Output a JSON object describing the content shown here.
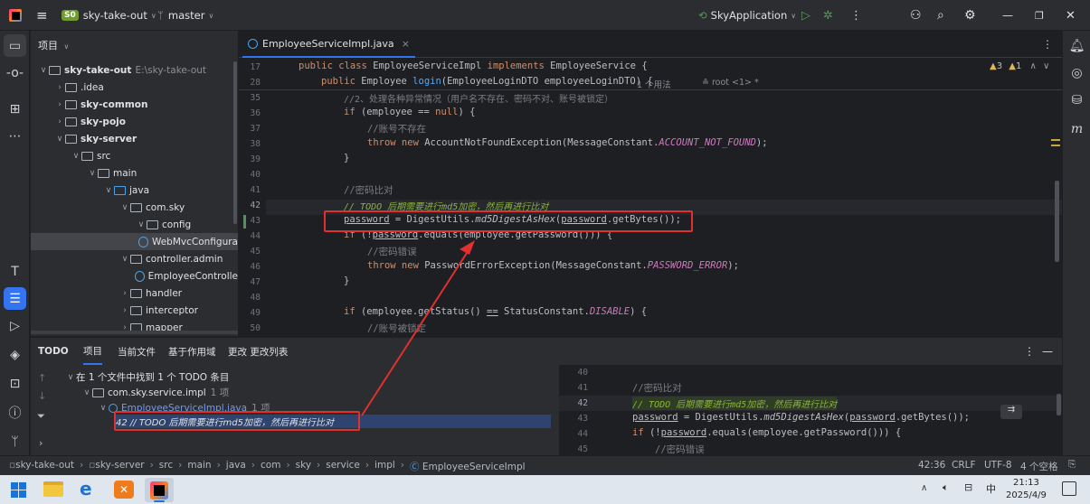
{
  "titlebar": {
    "app_badge": "S0",
    "project": "sky-take-out",
    "branch": "master",
    "run_config": "SkyApplication"
  },
  "project_panel": {
    "title": "项目",
    "root": {
      "name": "sky-take-out",
      "path": "E:\\sky-take-out"
    },
    "items": [
      ".idea",
      "sky-common",
      "sky-pojo",
      "sky-server",
      "src",
      "main",
      "java",
      "com.sky",
      "config",
      "WebMvcConfigura",
      "controller.admin",
      "EmployeeControlle",
      "handler",
      "interceptor",
      "mapper"
    ]
  },
  "editor": {
    "tab": "EmployeeServiceImpl.java",
    "inspections": {
      "warnings": "3",
      "weak": "1"
    },
    "sticky": [
      {
        "ln": "17",
        "text": "public class EmployeeServiceImpl implements EmployeeService {"
      },
      {
        "ln": "28",
        "text": "public Employee login(EmployeeLoginDTO employeeLoginDTO) {",
        "hint1": "1 个用法",
        "hint2": "root <1> *"
      }
    ],
    "lines": [
      {
        "ln": "35",
        "text": "//2、处理各种异常情况（用户名不存在、密码不对、账号被锁定）"
      },
      {
        "ln": "36",
        "text": "if (employee == null) {"
      },
      {
        "ln": "37",
        "text": "//账号不存在"
      },
      {
        "ln": "38",
        "text": "throw new AccountNotFoundException(MessageConstant.ACCOUNT_NOT_FOUND);"
      },
      {
        "ln": "39",
        "text": "}"
      },
      {
        "ln": "40",
        "text": ""
      },
      {
        "ln": "41",
        "text": "//密码比对"
      },
      {
        "ln": "42",
        "text": "// TODO 后期需要进行md5加密，然后再进行比对"
      },
      {
        "ln": "43",
        "text": "password = DigestUtils.md5DigestAsHex(password.getBytes());"
      },
      {
        "ln": "44",
        "text": "if (!password.equals(employee.getPassword())) {"
      },
      {
        "ln": "45",
        "text": "//密码错误"
      },
      {
        "ln": "46",
        "text": "throw new PasswordErrorException(MessageConstant.PASSWORD_ERROR);"
      },
      {
        "ln": "47",
        "text": "}"
      },
      {
        "ln": "48",
        "text": ""
      },
      {
        "ln": "49",
        "text": "if (employee.getStatus() == StatusConstant.DISABLE) {"
      },
      {
        "ln": "50",
        "text": "//账号被锁定"
      }
    ]
  },
  "bottom_panel": {
    "tabs": [
      "TODO",
      "项目",
      "当前文件",
      "基于作用域",
      "更改 更改列表"
    ],
    "summary": "在 1 个文件中找到 1 个 TODO 条目",
    "package": "com.sky.service.impl",
    "package_count": "1 项",
    "file": "EmployeeServiceImpl.java",
    "file_count": "1 项",
    "todo_item": "42 // TODO 后期需要进行md5加密，然后再进行比对",
    "preview_lines": [
      {
        "ln": "40",
        "text": ""
      },
      {
        "ln": "41",
        "text": "//密码比对"
      },
      {
        "ln": "42",
        "text": "// TODO 后期需要进行md5加密，然后再进行比对"
      },
      {
        "ln": "43",
        "text": "password = DigestUtils.md5DigestAsHex(password.getBytes());"
      },
      {
        "ln": "44",
        "text": "if (!password.equals(employee.getPassword())) {"
      },
      {
        "ln": "45",
        "text": "//密码错误"
      }
    ]
  },
  "statusbar": {
    "breadcrumb": [
      "sky-take-out",
      "sky-server",
      "src",
      "main",
      "java",
      "com",
      "sky",
      "service",
      "impl",
      "EmployeeServiceImpl"
    ],
    "position": "42:36",
    "line_sep": "CRLF",
    "encoding": "UTF-8",
    "indent": "4 个空格"
  },
  "taskbar": {
    "ime": "中",
    "time": "21:13",
    "date": "2025/4/9"
  },
  "colors": {
    "accent": "#3574f0",
    "annotation": "#e03030",
    "todo": "#8bb33d"
  }
}
